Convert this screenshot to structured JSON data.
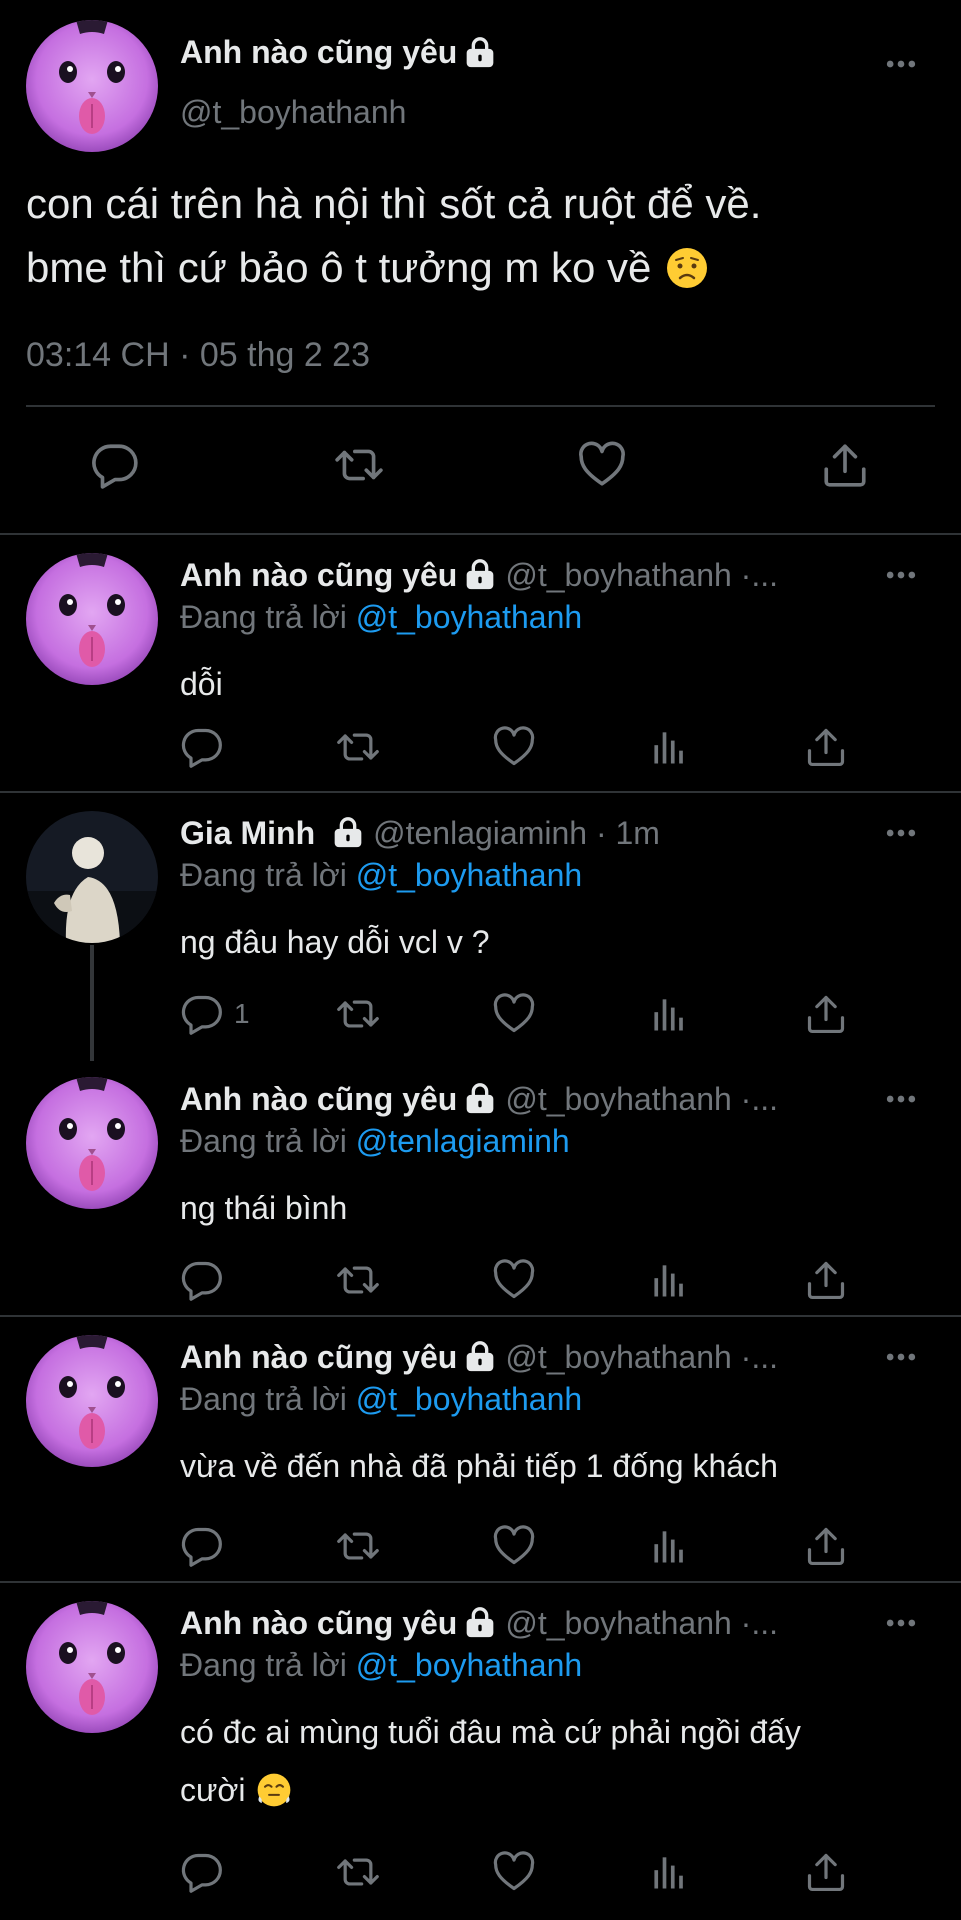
{
  "colors": {
    "background": "#000000",
    "text": "#e7e9ea",
    "muted": "#71767b",
    "link": "#1d9bf0",
    "divider": "#2f3336"
  },
  "main_tweet": {
    "display_name": "Anh nào cũng yêu",
    "handle": "@t_boyhathanh",
    "text_line1": "con cái trên hà nội thì sốt cả ruột để về.",
    "text_line2": "bme thì cứ bảo ô t tưởng m ko về",
    "emoji": "😟",
    "timestamp": "03:14 CH · 05 thg 2 23",
    "icons": {
      "lock": "lock-icon",
      "more": "more-icon",
      "reply": "reply-icon",
      "retweet": "retweet-icon",
      "like": "like-icon",
      "share": "share-icon"
    }
  },
  "replies": [
    {
      "display_name": "Anh nào cũng yêu",
      "handle": "@t_boyhathanh ·...",
      "replying_prefix": "Đang trả lời",
      "replying_to": "@t_boyhathanh",
      "text_line1": "dỗi",
      "text_line2": "",
      "reply_count": ""
    },
    {
      "display_name": "Gia Minh",
      "handle": "@tenlagiaminh · 1m",
      "replying_prefix": "Đang trả lời",
      "replying_to": "@t_boyhathanh",
      "text_line1": "ng đâu hay dỗi vcl v ?",
      "text_line2": "",
      "reply_count": "1"
    },
    {
      "display_name": "Anh nào cũng yêu",
      "handle": "@t_boyhathanh ·...",
      "replying_prefix": "Đang trả lời",
      "replying_to": "@tenlagiaminh",
      "text_line1": "ng thái bình",
      "text_line2": "",
      "reply_count": ""
    },
    {
      "display_name": "Anh nào cũng yêu",
      "handle": "@t_boyhathanh ·...",
      "replying_prefix": "Đang trả lời",
      "replying_to": "@t_boyhathanh",
      "text_line1": "vừa về đến nhà đã phải tiếp 1 đống khách",
      "text_line2": "",
      "reply_count": ""
    },
    {
      "display_name": "Anh nào cũng yêu",
      "handle": "@t_boyhathanh ·...",
      "replying_prefix": "Đang trả lời",
      "replying_to": "@t_boyhathanh",
      "text_line1": "có đc ai mùng tuổi đâu mà cứ phải ngồi đấy",
      "text_line2": "cười",
      "emoji": "😤",
      "reply_count": ""
    }
  ]
}
